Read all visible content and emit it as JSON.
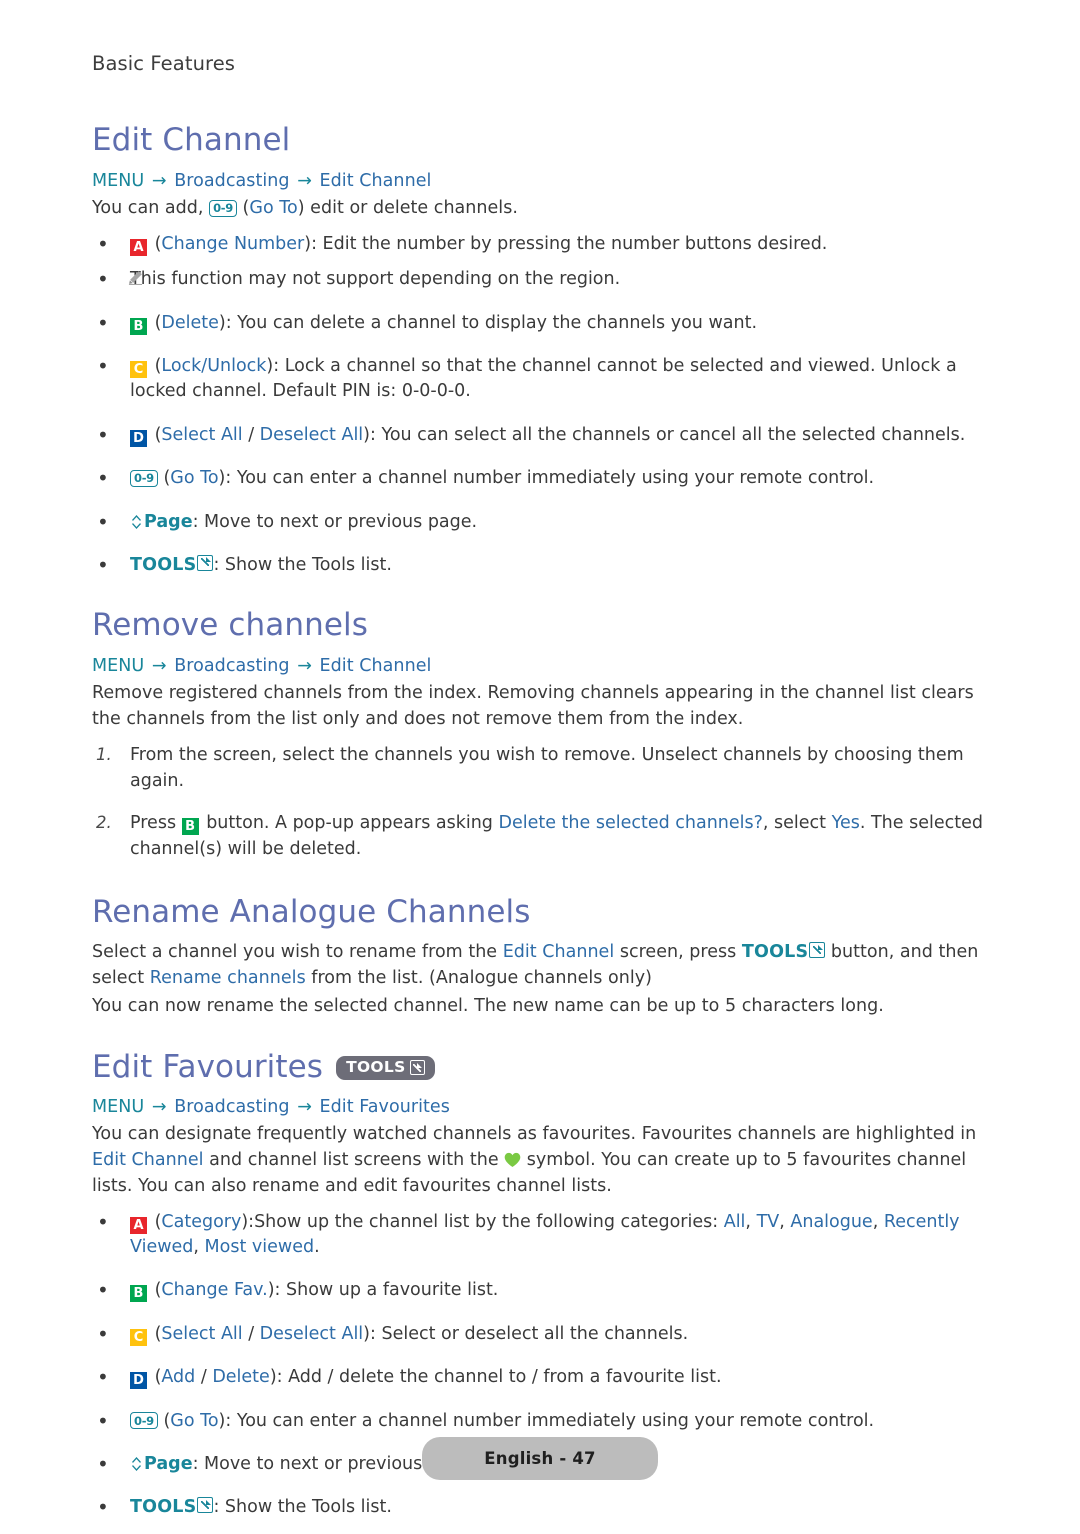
{
  "running_head": "Basic Features",
  "colors": {
    "heading": "#5f6eae",
    "link_blue": "#2e6ca8",
    "teal": "#19869a",
    "key_a_red": "#e8262c",
    "key_b_green": "#00a650",
    "key_c_yellow": "#ffc20e",
    "key_d_blue": "#0055a5",
    "heart_green": "#7ac943",
    "tools_pill_bg": "#6d6d78",
    "footer_pill_bg": "#bcbcbc",
    "note_gray": "#8c8c8c"
  },
  "sections": {
    "edit_channel": {
      "title": "Edit Channel",
      "path": {
        "menu": "MENU",
        "arrow": "→",
        "level1": "Broadcasting",
        "level2": "Edit Channel"
      },
      "intro_a": "You can add, ",
      "intro_numkey": "0-9",
      "intro_b": " (",
      "intro_goto": "Go To",
      "intro_c": ") edit or delete channels.",
      "bullets": [
        {
          "key": "A",
          "key_color": "red",
          "label": "Change Number",
          "text": ": Edit the number by pressing the number buttons desired."
        },
        {
          "key": "B",
          "key_color": "green",
          "label": "Delete",
          "text": ": You can delete a channel to display the channels you want."
        },
        {
          "key": "C",
          "key_color": "yellow",
          "label": "Lock/Unlock",
          "text": ": Lock a channel so that the channel cannot be selected and viewed. Unlock a locked channel. Default PIN is: 0-0-0-0."
        },
        {
          "key": "D",
          "key_color": "blue",
          "label": "Select All",
          "label2": "Deselect All",
          "text": ": You can select all the channels or cancel all the selected channels."
        }
      ],
      "note": "This function may not support depending on the region.",
      "goto_item": {
        "numkey": "0-9",
        "label": "Go To",
        "text": ": You can enter a channel number immediately using your remote control."
      },
      "page_item": {
        "label": "Page",
        "text": ": Move to next or previous page."
      },
      "tools_item": {
        "label": "TOOLS",
        "text": ": Show the Tools list."
      }
    },
    "remove_channels": {
      "title": "Remove channels",
      "path": {
        "menu": "MENU",
        "arrow": "→",
        "level1": "Broadcasting",
        "level2": "Edit Channel"
      },
      "intro": "Remove registered channels from the index. Removing channels appearing in the channel list clears the channels from the list only and does not remove them from the index.",
      "steps": [
        {
          "text": "From the screen, select the channels you wish to remove. Unselect channels by choosing them again."
        },
        {
          "pre": "Press ",
          "key": "B",
          "key_color": "green",
          "mid": " button. A pop-up appears asking ",
          "link1": "Delete the selected channels?",
          "mid2": ", select ",
          "link2": "Yes",
          "post": ". The selected channel(s) will be deleted."
        }
      ]
    },
    "rename_analogue": {
      "title": "Rename Analogue Channels",
      "para_a": "Select a channel you wish to rename from the ",
      "link_edit_channel": "Edit Channel",
      "para_b": " screen, press ",
      "tools_label": "TOOLS",
      "para_c": " button, and then select ",
      "link_rename": "Rename channels",
      "para_d": " from the list. (Analogue channels only)",
      "para_e": "You can now rename the selected channel. The new name can be up to 5 characters long."
    },
    "edit_favourites": {
      "title": "Edit Favourites",
      "title_badge": "TOOLS",
      "path": {
        "menu": "MENU",
        "arrow": "→",
        "level1": "Broadcasting",
        "level2": "Edit Favourites"
      },
      "intro_a": "You can designate frequently watched channels as favourites. Favourites channels are highlighted in ",
      "intro_link": "Edit Channel",
      "intro_b": " and channel list screens with the ",
      "intro_c": " symbol. You can create up to 5 favourites channel lists. You can also rename and edit favourites channel lists.",
      "bullets": [
        {
          "key": "A",
          "key_color": "red",
          "label": "Category",
          "text": ":Show up the channel list by the following categories: ",
          "categories": [
            "All",
            "TV",
            "Analogue",
            "Recently Viewed",
            "Most viewed"
          ],
          "tail": "."
        },
        {
          "key": "B",
          "key_color": "green",
          "label": "Change Fav.",
          "text": ": Show up a favourite list."
        },
        {
          "key": "C",
          "key_color": "yellow",
          "label": "Select All",
          "label2": "Deselect All",
          "text": ": Select or deselect all the channels."
        },
        {
          "key": "D",
          "key_color": "blue",
          "label": "Add",
          "label2": "Delete",
          "text": ": Add / delete the channel to / from a favourite list."
        }
      ],
      "goto_item": {
        "numkey": "0-9",
        "label": "Go To",
        "text": ": You can enter a channel number immediately using your remote control."
      },
      "page_item": {
        "label": "Page",
        "text": ": Move to next or previous page."
      },
      "tools_item": {
        "label": "TOOLS",
        "text": ": Show the Tools list."
      }
    }
  },
  "footer": {
    "label": "English - 47"
  }
}
